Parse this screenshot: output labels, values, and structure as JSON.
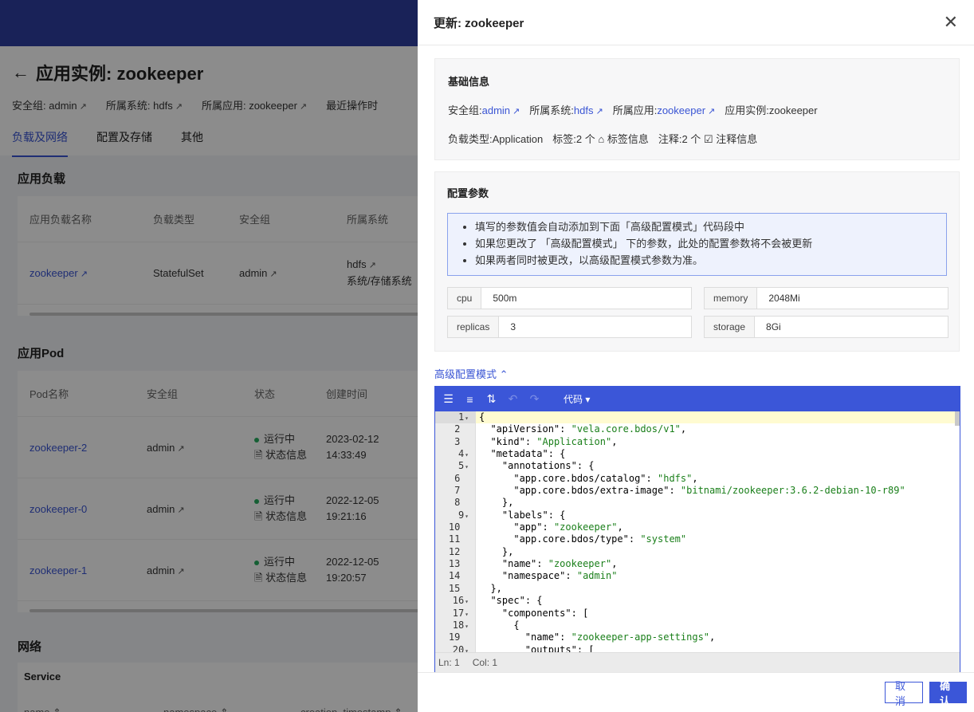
{
  "background": {
    "page_title": "应用实例: zookeeper",
    "meta": [
      {
        "label": "安全组:",
        "value": "admin"
      },
      {
        "label": "所属系统:",
        "value": "hdfs"
      },
      {
        "label": "所属应用:",
        "value": "zookeeper"
      },
      {
        "label": "最近操作时",
        "value": ""
      }
    ],
    "tabs": [
      "负载及网络",
      "配置及存储",
      "其他"
    ],
    "workload_section": "应用负载",
    "workload_headers": [
      "应用负载名称",
      "负载类型",
      "安全组",
      "所属系统"
    ],
    "workload_rows": [
      {
        "name": "zookeeper",
        "type": "StatefulSet",
        "group": "admin",
        "system": "hdfs",
        "system2": "系统/存储系统"
      }
    ],
    "pod_section": "应用Pod",
    "pod_headers": [
      "Pod名称",
      "安全组",
      "状态",
      "创建时间"
    ],
    "pod_rows": [
      {
        "name": "zookeeper-2",
        "group": "admin",
        "status": "运行中",
        "status_info": "状态信息",
        "date": "2023-02-12",
        "time": "14:33:49"
      },
      {
        "name": "zookeeper-0",
        "group": "admin",
        "status": "运行中",
        "status_info": "状态信息",
        "date": "2022-12-05",
        "time": "19:21:16"
      },
      {
        "name": "zookeeper-1",
        "group": "admin",
        "status": "运行中",
        "status_info": "状态信息",
        "date": "2022-12-05",
        "time": "19:20:57"
      }
    ],
    "network_section": "网络",
    "service_label": "Service",
    "service_headers": [
      "name",
      "namespace",
      "creation_timestamp"
    ]
  },
  "drawer": {
    "title": "更新: zookeeper",
    "basic": {
      "title": "基础信息",
      "security_group_label": "安全组:",
      "security_group": "admin",
      "system_label": "所属系统:",
      "system": "hdfs",
      "app_label": "所属应用:",
      "app": "zookeeper",
      "instance_label": "应用实例:",
      "instance": "zookeeper",
      "workload_type_label": "负载类型:",
      "workload_type": "Application",
      "tags_label": "标签:",
      "tags_count": "2 个",
      "tags_info": "标签信息",
      "annotations_label": "注释:",
      "annotations_count": "2 个",
      "annotations_info": "注释信息"
    },
    "params": {
      "title": "配置参数",
      "notices": [
        "填写的参数值会自动添加到下面「高级配置模式」代码段中",
        "如果您更改了 「高级配置模式」 下的参数，此处的配置参数将不会被更新",
        "如果两者同时被更改，以高级配置模式参数为准。"
      ],
      "fields": [
        {
          "key": "cpu",
          "value": "500m"
        },
        {
          "key": "memory",
          "value": "2048Mi"
        },
        {
          "key": "replicas",
          "value": "3"
        },
        {
          "key": "storage",
          "value": "8Gi"
        }
      ]
    },
    "advanced_toggle": "高级配置模式 ⌃",
    "editor": {
      "mode": "代码 ▾",
      "status_ln": "Ln: 1",
      "status_col": "Col: 1",
      "code_lines": [
        "{",
        "  \"apiVersion\": \"vela.core.bdos/v1\",",
        "  \"kind\": \"Application\",",
        "  \"metadata\": {",
        "    \"annotations\": {",
        "      \"app.core.bdos/catalog\": \"hdfs\",",
        "      \"app.core.bdos/extra-image\": \"bitnami/zookeeper:3.6.2-debian-10-r89\"",
        "    },",
        "    \"labels\": {",
        "      \"app\": \"zookeeper\",",
        "      \"app.core.bdos/type\": \"system\"",
        "    },",
        "    \"name\": \"zookeeper\",",
        "    \"namespace\": \"admin\"",
        "  },",
        "  \"spec\": {",
        "    \"components\": [",
        "      {",
        "        \"name\": \"zookeeper-app-settings\",",
        "        \"outputs\": ["
      ],
      "fold_lines": [
        1,
        4,
        5,
        9,
        16,
        17,
        18,
        20
      ]
    },
    "cancel": "取消",
    "confirm": "确认"
  }
}
